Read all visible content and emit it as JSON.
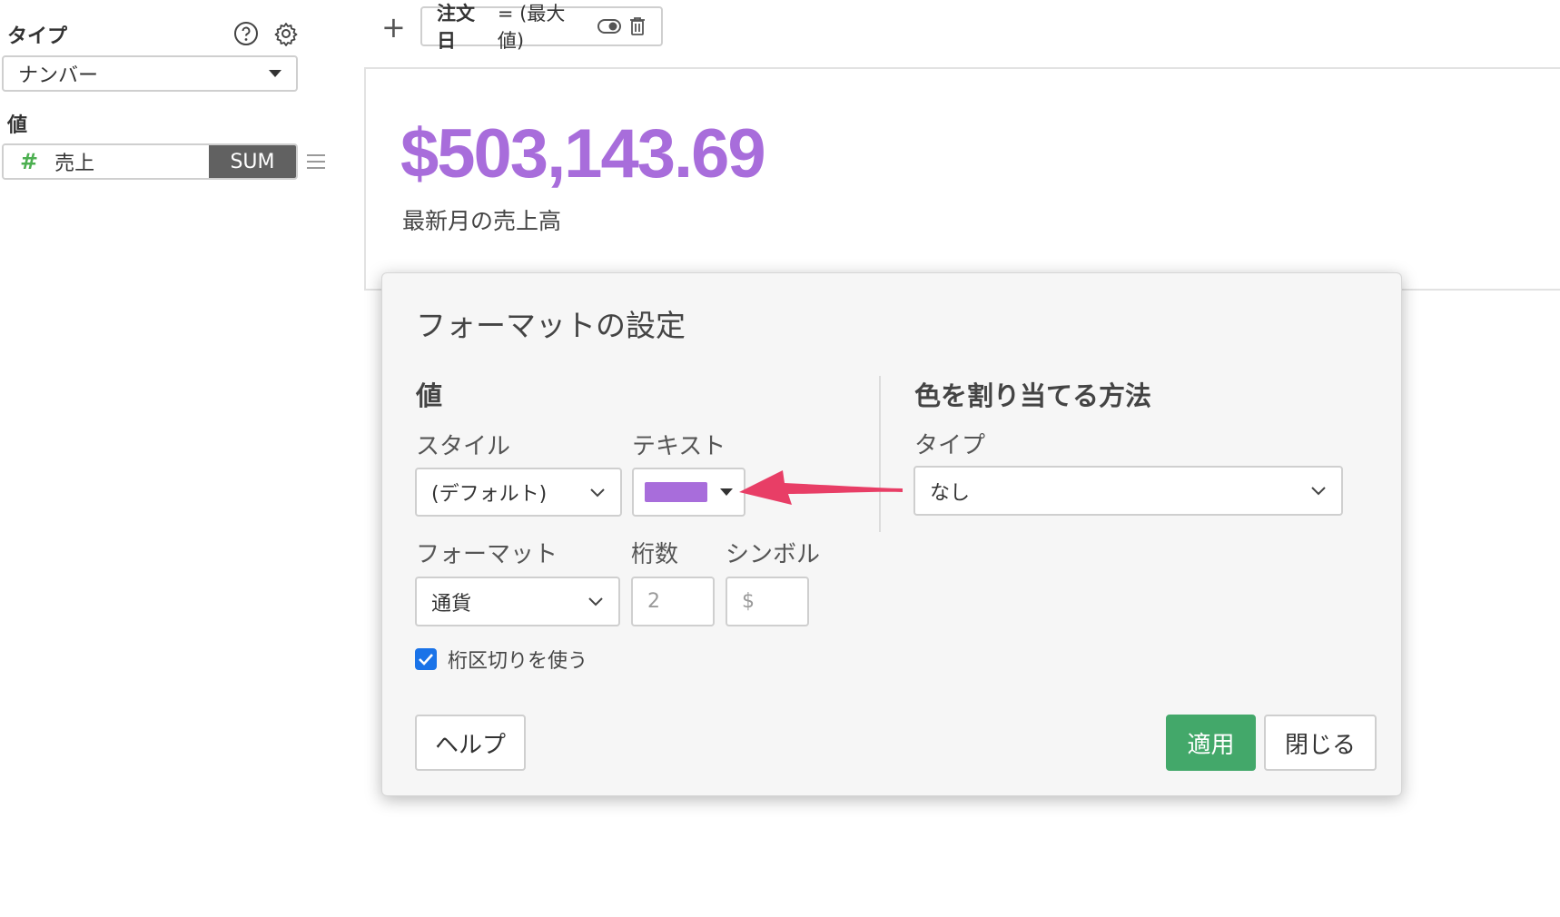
{
  "left_panel": {
    "type_label": "タイプ",
    "type_select": "ナンバー",
    "value_label": "値",
    "value_field": {
      "name": "売上",
      "aggregation": "SUM"
    }
  },
  "filter_bar": {
    "chip": {
      "field": "注文日",
      "condition": "= (最大値)"
    }
  },
  "card": {
    "value": "$503,143.69",
    "subtitle": "最新月の売上高",
    "value_color": "#a86ddb"
  },
  "dialog": {
    "title": "フォーマットの設定",
    "value_section": {
      "title": "値",
      "style_label": "スタイル",
      "style_value": "(デフォルト)",
      "text_label": "テキスト",
      "text_color": "#a86ddb",
      "format_label": "フォーマット",
      "format_value": "通貨",
      "digits_label": "桁数",
      "digits_placeholder": "2",
      "symbol_label": "シンボル",
      "symbol_placeholder": "$",
      "separator_label": "桁区切りを使う",
      "separator_checked": true
    },
    "color_section": {
      "title": "色を割り当てる方法",
      "type_label": "タイプ",
      "type_value": "なし"
    },
    "buttons": {
      "help": "ヘルプ",
      "apply": "適用",
      "close": "閉じる"
    }
  },
  "colors": {
    "accent_purple": "#a86ddb",
    "apply_green": "#43a86a",
    "checkbox_blue": "#1a73e8",
    "arrow_pink": "#e83e66"
  }
}
